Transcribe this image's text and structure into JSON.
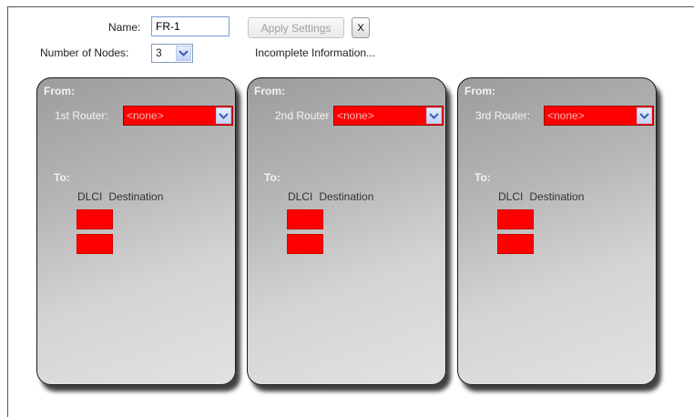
{
  "form": {
    "name_label": "Name:",
    "name_value": "FR-1",
    "nodes_label": "Number of Nodes:",
    "nodes_value": "3"
  },
  "toolbar": {
    "apply_label": "Apply Settings",
    "close_label": "X",
    "status_text": "Incomplete Information..."
  },
  "panels": [
    {
      "from_label": "From:",
      "router_label": "1st Router:",
      "router_value": "<none>",
      "to_label": "To:",
      "col_dlci": "DLCI",
      "col_destination": "Destination"
    },
    {
      "from_label": "From:",
      "router_label": "2nd Router",
      "router_value": "<none>",
      "to_label": "To:",
      "col_dlci": "DLCI",
      "col_destination": "Destination"
    },
    {
      "from_label": "From:",
      "router_label": "3rd Router:",
      "router_value": "<none>",
      "to_label": "To:",
      "col_dlci": "DLCI",
      "col_destination": "Destination"
    }
  ],
  "colors": {
    "invalid_field": "#ff0000",
    "panel_border": "#1a1a1a",
    "status_text": "#222222"
  },
  "icons": [
    "chevron-down-icon",
    "close-icon"
  ]
}
